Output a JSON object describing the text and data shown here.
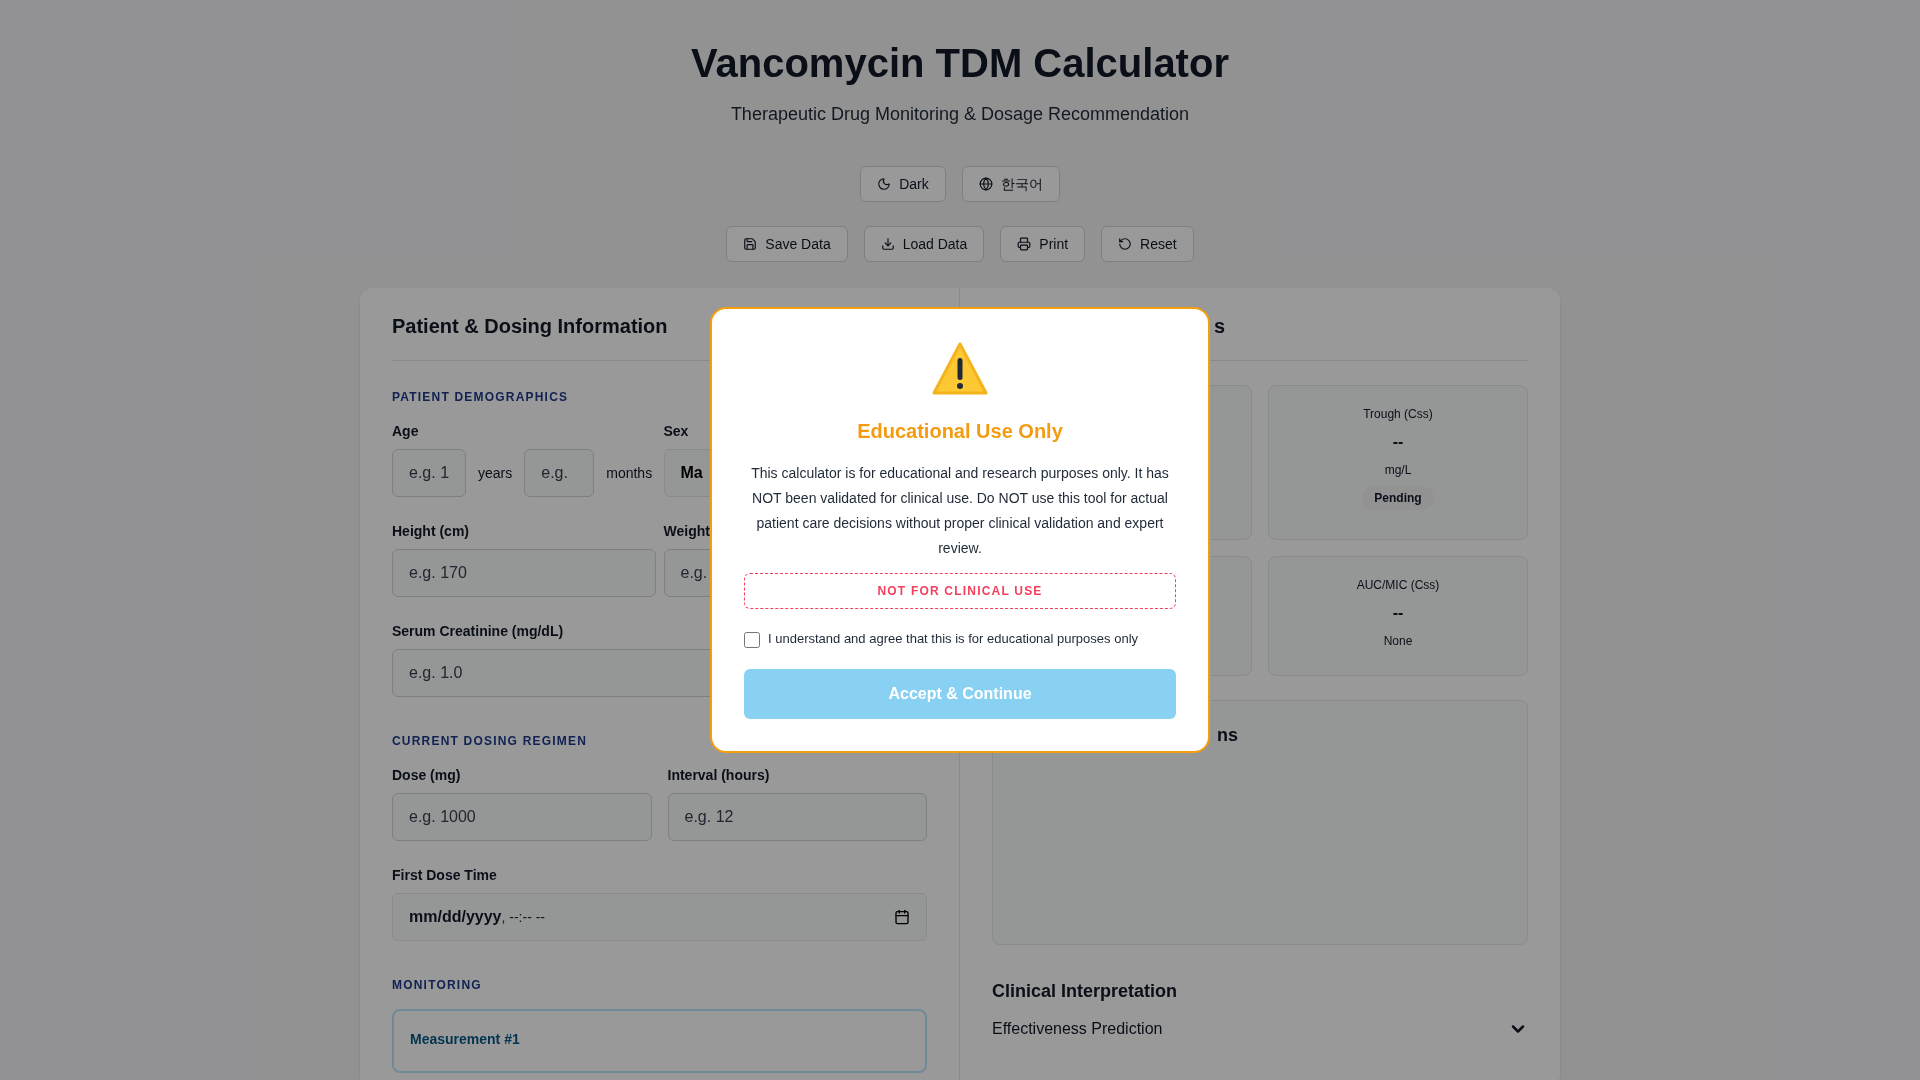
{
  "header": {
    "title": "Vancomycin TDM Calculator",
    "subtitle": "Therapeutic Drug Monitoring & Dosage Recommendation"
  },
  "top_buttons": [
    {
      "label": "Dark",
      "kind": "theme"
    },
    {
      "label": "한국어",
      "kind": "language"
    }
  ],
  "actions": [
    {
      "label": "Save Data",
      "kind": "save"
    },
    {
      "label": "Load Data",
      "kind": "load"
    },
    {
      "label": "Print",
      "kind": "print"
    },
    {
      "label": "Reset",
      "kind": "reset"
    }
  ],
  "left_panel": {
    "title": "Patient & Dosing Information",
    "demographics": {
      "heading": "PATIENT DEMOGRAPHICS",
      "age_label": "Age",
      "age_years_placeholder": "e.g. 1",
      "years_unit": "years",
      "age_months_placeholder": "e.g.",
      "months_unit": "months",
      "sex_label": "Sex",
      "sex_value": "Ma",
      "height_label": "Height (cm)",
      "height_placeholder": "e.g. 170",
      "weight_label": "Weight",
      "weight_placeholder": "e.g.",
      "scr_label": "Serum Creatinine (mg/dL)",
      "scr_placeholder": "e.g. 1.0"
    },
    "dosing": {
      "heading": "CURRENT DOSING REGIMEN",
      "dose_label": "Dose (mg)",
      "dose_placeholder": "e.g. 1000",
      "interval_label": "Interval (hours)",
      "interval_placeholder": "e.g. 12",
      "time_label": "First Dose Time",
      "time_date": "mm/dd/yyyy",
      "time_clock": ", --:-- --"
    },
    "monitoring": {
      "heading": "MONITORING",
      "measurement_title": "Measurement #1"
    }
  },
  "right_panel": {
    "title_fragment": "s",
    "cards": [
      {
        "label": "Trough (Css)",
        "value": "--",
        "unit": "mg/L",
        "badge": "Pending"
      },
      {
        "label": "AUC/MIC (Css)",
        "value": "--",
        "unit": "None"
      }
    ],
    "chart_title_fragment": "ns",
    "interpretation": {
      "title": "Clinical Interpretation",
      "item": "Effectiveness Prediction",
      "expanded": false
    }
  },
  "modal": {
    "title": "Educational Use Only",
    "body": "This calculator is for educational and research purposes only. It has NOT been validated for clinical use. Do NOT use this tool for actual patient care decisions without proper clinical validation and expert review.",
    "badge": "NOT FOR CLINICAL USE",
    "agree_label": "I understand and agree that this is for educational purposes only",
    "agree_checked": false,
    "button": "Accept & Continue",
    "button_disabled": true
  }
}
